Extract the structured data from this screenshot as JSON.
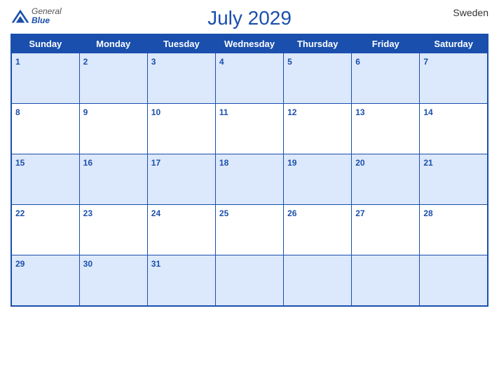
{
  "header": {
    "title": "July 2029",
    "country": "Sweden",
    "logo": {
      "general": "General",
      "blue": "Blue"
    }
  },
  "weekdays": [
    "Sunday",
    "Monday",
    "Tuesday",
    "Wednesday",
    "Thursday",
    "Friday",
    "Saturday"
  ],
  "weeks": [
    [
      1,
      2,
      3,
      4,
      5,
      6,
      7
    ],
    [
      8,
      9,
      10,
      11,
      12,
      13,
      14
    ],
    [
      15,
      16,
      17,
      18,
      19,
      20,
      21
    ],
    [
      22,
      23,
      24,
      25,
      26,
      27,
      28
    ],
    [
      29,
      30,
      31,
      null,
      null,
      null,
      null
    ]
  ],
  "colors": {
    "primary": "#1a4fad",
    "header_bg": "#1a4fad",
    "row_bg": "#dce8fb",
    "white": "#ffffff"
  }
}
